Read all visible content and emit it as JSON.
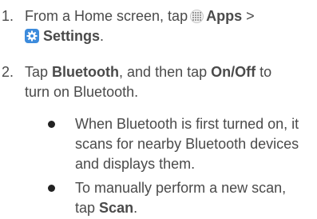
{
  "steps": [
    {
      "number": "1.",
      "line1_prefix": "From a Home screen, tap",
      "apps_icon": "apps-grid-icon",
      "apps_label": "Apps",
      "separator": ">",
      "settings_icon": "settings-gear-icon",
      "settings_label": "Settings",
      "settings_suffix": "."
    },
    {
      "number": "2.",
      "t1": "Tap",
      "bluetooth_label": "Bluetooth",
      "t2": ", and then tap",
      "onoff_label": "On/Off",
      "t3": "to",
      "line2": "turn on Bluetooth."
    }
  ],
  "bullets": [
    {
      "lines": [
        "When Bluetooth is first turned on, it",
        "scans for nearby Bluetooth devices",
        "and displays them."
      ]
    },
    {
      "line1": "To manually perform a new scan,",
      "line2_prefix": "tap",
      "scan_label": "Scan",
      "line2_suffix": "."
    }
  ],
  "colors": {
    "text": "#4a4a4a",
    "settings_icon_bg": "#3c8bdc",
    "bullet_dot": "#222222"
  }
}
